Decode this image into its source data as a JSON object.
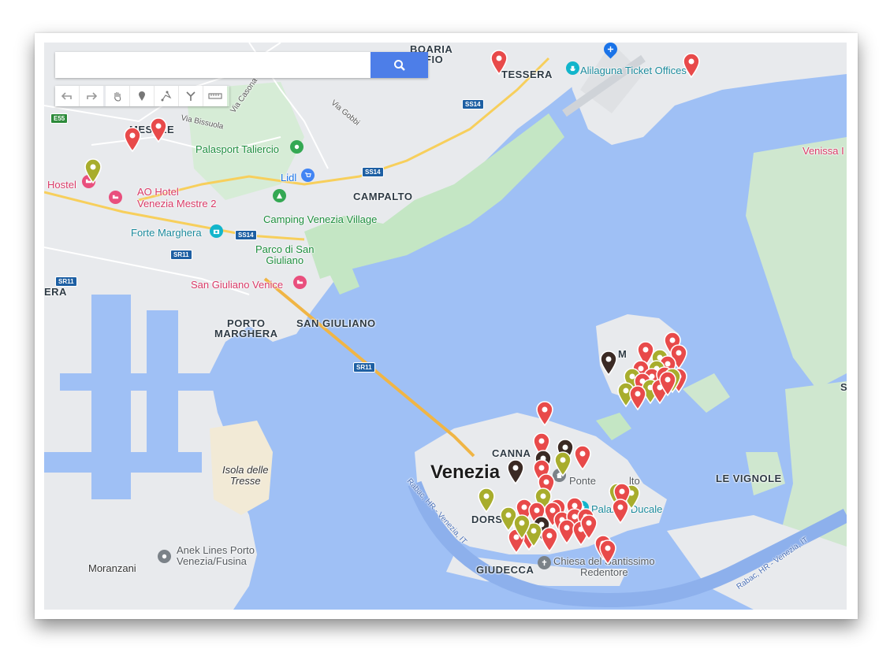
{
  "search": {
    "value": "",
    "placeholder": ""
  },
  "toolbar": {
    "tools": [
      "undo-icon",
      "redo-icon",
      "hand-icon",
      "marker-icon",
      "line-icon",
      "directions-icon",
      "ruler-icon"
    ]
  },
  "labels": {
    "boaria_offio": "BOARIA\nOFFIO",
    "tessera": "TESSERA",
    "alilaguna": "Alilaguna Ticket Offices",
    "mestre": "MESTRE",
    "via_bissuola": "Via Bissuola",
    "via_casona": "Via Casona",
    "via_gobbi": "Via Gobbi",
    "palasport": "Palasport Taliercio",
    "lidl": "Lidl",
    "hostel": "Hostel",
    "ao_hotel": "AO Hotel\nVenezia Mestre 2",
    "campalto": "CAMPALTO",
    "camping": "Camping Venezia Village",
    "forte": "Forte Marghera",
    "parco": "Parco di San\nGiuliano",
    "san_giuliano_venice": "San Giuliano Venice",
    "era": "ERA",
    "porto_marghera": "PORTO\nMARGHERA",
    "san_giuliano": "SAN GIULIANO",
    "venissa": "Venissa I",
    "s_edge": "S",
    "isola": "Isola delle\nTresse",
    "venezia": "Venezia",
    "cannaregio": "CANNA",
    "ponte": "Ponte",
    "rialto": "lto",
    "palazzo": "Palazzo Ducale",
    "le_vignole": "LE VIGNOLE",
    "dorso": "DORSO",
    "giudecca": "GIUDECCA",
    "chiesa": "Chiesa del Santissimo\nRedentore",
    "anek": "Anek Lines Porto\nVenezia/Fusina",
    "moranzani": "Moranzani",
    "murano": "M",
    "rabac1": "Rabac, HR - Venezia, IT",
    "rabac2": "Rabac, HR - Venezia, IT"
  },
  "roads": {
    "ss14_a": "SS14",
    "ss14_b": "SS14",
    "ss14_c": "SS14",
    "sr11_a": "SR11",
    "sr11_b": "SR11",
    "sr11_c": "SR11",
    "e55": "E55"
  },
  "colors": {
    "water": "#9fc0f5",
    "land": "#e8eaed",
    "green_land": "#c4e6c4",
    "marker_red": "#e84a4a",
    "marker_olive": "#a8ad2d",
    "marker_dark": "#3b2a24",
    "search_button": "#4d7ee8"
  },
  "markers": {
    "red": 58,
    "olive": 14,
    "dark": 5
  }
}
